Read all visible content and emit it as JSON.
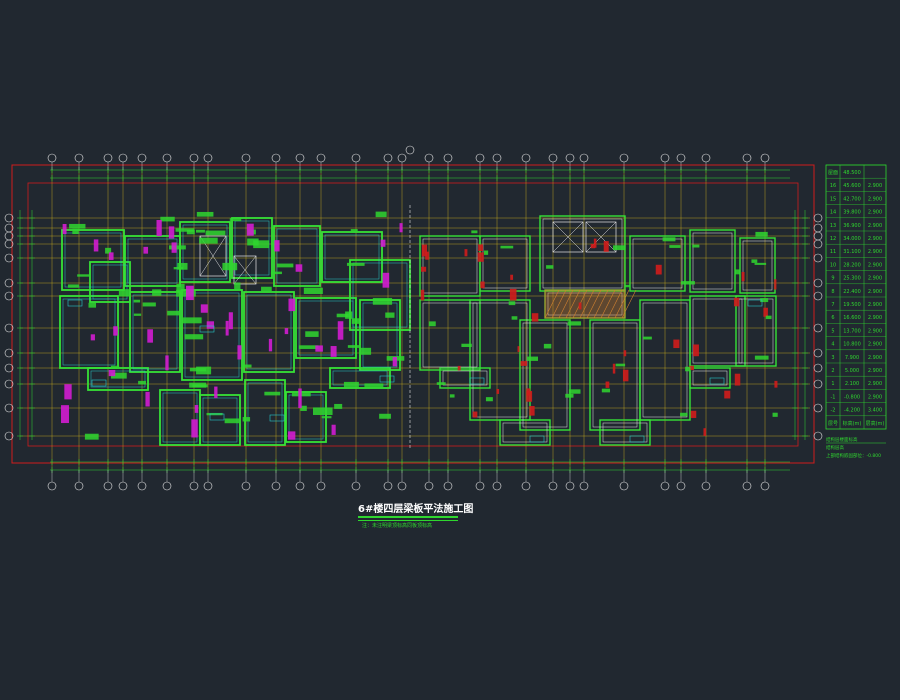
{
  "drawing": {
    "title": "6#楼四层梁板平法施工图",
    "subtitle": "注：未注明梁顶标高同板顶标高"
  },
  "colors": {
    "background": "#212830",
    "border_red": "#d01c1c",
    "grid_yellow": "#d8b81c",
    "wall_green": "#36e236",
    "text_green": "#2fd62f",
    "slab_magenta": "#d21cd2",
    "beam_cyan": "#27c8c8",
    "beam_white": "#e6e6e6",
    "hatch_orange": "#d08030"
  },
  "right_table": {
    "rows": [
      {
        "floor": "屋面",
        "elev": "48.500",
        "height": ""
      },
      {
        "floor": "16",
        "elev": "45.600",
        "height": "2.900"
      },
      {
        "floor": "15",
        "elev": "42.700",
        "height": "2.900"
      },
      {
        "floor": "14",
        "elev": "39.800",
        "height": "2.900"
      },
      {
        "floor": "13",
        "elev": "36.900",
        "height": "2.900"
      },
      {
        "floor": "12",
        "elev": "34.000",
        "height": "2.900"
      },
      {
        "floor": "11",
        "elev": "31.100",
        "height": "2.900"
      },
      {
        "floor": "10",
        "elev": "28.200",
        "height": "2.900"
      },
      {
        "floor": "9",
        "elev": "25.300",
        "height": "2.900"
      },
      {
        "floor": "8",
        "elev": "22.400",
        "height": "2.900"
      },
      {
        "floor": "7",
        "elev": "19.500",
        "height": "2.900"
      },
      {
        "floor": "6",
        "elev": "16.600",
        "height": "2.900"
      },
      {
        "floor": "5",
        "elev": "13.700",
        "height": "2.900"
      },
      {
        "floor": "4",
        "elev": "10.800",
        "height": "2.900"
      },
      {
        "floor": "3",
        "elev": "7.900",
        "height": "2.900"
      },
      {
        "floor": "2",
        "elev": "5.000",
        "height": "2.900"
      },
      {
        "floor": "1",
        "elev": "2.100",
        "height": "2.900"
      },
      {
        "floor": "-1",
        "elev": "-0.800",
        "height": "2.900"
      },
      {
        "floor": "-2",
        "elev": "-4.200",
        "height": "3.400"
      },
      {
        "floor": "层号",
        "elev": "标高(m)",
        "height": "层高(m)"
      }
    ],
    "footer_lines": [
      "结构层楼面标高",
      "结构层高",
      "上部结构嵌固部位：-0.800"
    ]
  }
}
